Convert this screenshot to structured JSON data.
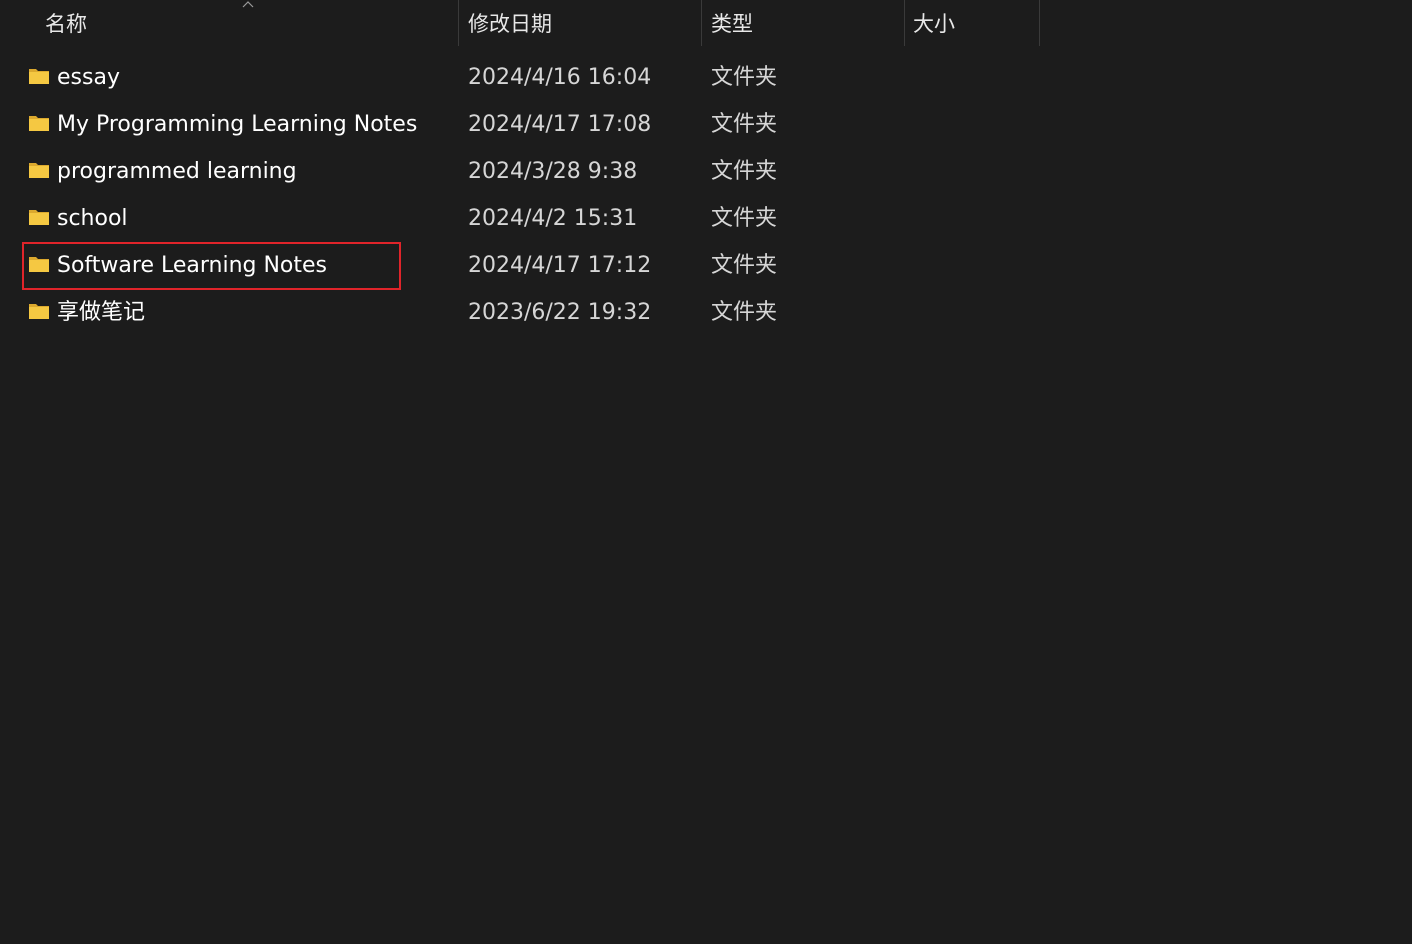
{
  "columns": {
    "name": "名称",
    "modified": "修改日期",
    "type": "类型",
    "size": "大小"
  },
  "sort": {
    "column": "name",
    "icon": "sort-caret-up-icon"
  },
  "rows": [
    {
      "name": "essay",
      "modified": "2024/4/16 16:04",
      "type": "文件夹",
      "icon": "folder-icon"
    },
    {
      "name": "My Programming Learning Notes",
      "modified": "2024/4/17 17:08",
      "type": "文件夹",
      "icon": "folder-icon"
    },
    {
      "name": "programmed learning",
      "modified": "2024/3/28 9:38",
      "type": "文件夹",
      "icon": "folder-icon"
    },
    {
      "name": "school",
      "modified": "2024/4/2 15:31",
      "type": "文件夹",
      "icon": "folder-icon"
    },
    {
      "name": "Software Learning Notes",
      "modified": "2024/4/17 17:12",
      "type": "文件夹",
      "icon": "folder-icon",
      "highlighted": true
    },
    {
      "name": "享做笔记",
      "modified": "2023/6/22 19:32",
      "type": "文件夹",
      "icon": "folder-icon"
    }
  ],
  "colors": {
    "background": "#1c1c1c",
    "folder": "#f5c842",
    "highlight": "#e0242a"
  }
}
